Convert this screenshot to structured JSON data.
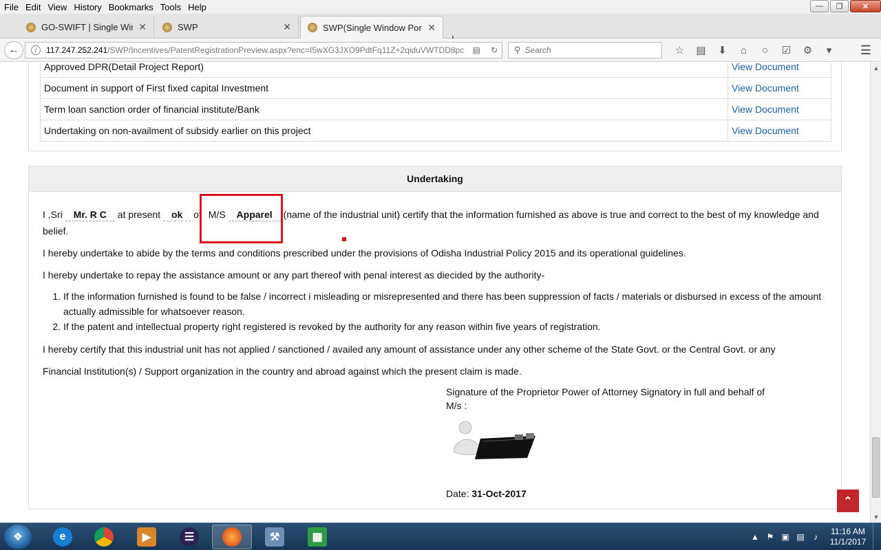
{
  "menubar": {
    "items": [
      "File",
      "Edit",
      "View",
      "History",
      "Bookmarks",
      "Tools",
      "Help"
    ]
  },
  "tabs": [
    {
      "title": "GO-SWIFT | Single Window...",
      "active": false
    },
    {
      "title": "SWP",
      "active": false
    },
    {
      "title": "SWP(Single Window Portal)",
      "active": true
    }
  ],
  "address": {
    "host": "117.247.252.241",
    "path": "/SWP/Incentives/PatentRegistrationPreview.aspx?enc=I5wXG3JXO9PdtFq11Z+2qiduVWTDD8pc"
  },
  "search": {
    "placeholder": "Search"
  },
  "documents": {
    "rows": [
      {
        "name": "Approved DPR(Detail Project Report)",
        "link": "View Document"
      },
      {
        "name": "Document in support of First fixed capital Investment",
        "link": "View Document"
      },
      {
        "name": "Term loan sanction order of financial institute/Bank",
        "link": "View Document"
      },
      {
        "name": "Undertaking on non-availment of subsidy earlier on this project",
        "link": "View Document"
      }
    ]
  },
  "undertaking": {
    "heading": "Undertaking",
    "prefix": "I ,Sri",
    "name_value": "Mr. R C",
    "at_present": "at present",
    "present_value": "ok",
    "of": "of",
    "ms_label": "M/S",
    "unit_value": "Apparel",
    "certify_text": "(name of the industrial unit) certify that the information furnished as above is true and correct to the best of my knowledge and belief.",
    "abide_text": "I hereby undertake to abide by the terms and conditions prescribed under the provisions of Odisha Industrial Policy 2015 and its operational guidelines.",
    "repay_text": "I hereby undertake to repay the assistance amount or any part thereof with penal interest as diecided by the authority-",
    "conditions": [
      "If the information furnished is found to be false / incorrect i misleading or misrepresented and there has been suppression of facts / materials or disbursed in excess of the amount actually admissible for whatsoever reason.",
      "If the patent and intellectual property right registered is revoked by the authority for any reason within five years of registration."
    ],
    "certify_unit_text": "I hereby certify that this industrial unit has not applied / sanctioned / availed any amount of assistance under any other scheme of the State Govt. or the Central Govt. or any",
    "institution_text": "Financial Institution(s) / Support organization in the country and abroad against which the present claim is made.",
    "signature_label": "Signature of the Proprietor Power of Attorney Signatory in full and behalf of",
    "ms_colon": "M/s :",
    "date_label": "Date:",
    "date_value": "31-Oct-2017"
  },
  "taskbar": {
    "clock_time": "11:16 AM",
    "clock_date": "11/1/2017"
  },
  "colors": {
    "link": "#1f5f9e",
    "highlight": "#d9121b",
    "back_to_top": "#c0262a"
  }
}
